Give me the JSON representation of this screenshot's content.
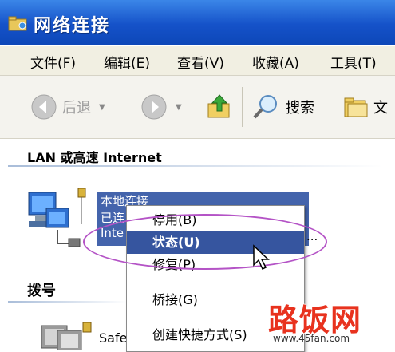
{
  "window": {
    "title": "网络连接",
    "icon": "network-folder-icon"
  },
  "menubar": {
    "items": [
      "文件(F)",
      "编辑(E)",
      "查看(V)",
      "收藏(A)",
      "工具(T)"
    ]
  },
  "toolbar": {
    "back_label": "后退",
    "search_label": "搜索",
    "folders_label": "文",
    "icons": [
      "back-arrow-icon",
      "forward-arrow-icon",
      "up-folder-icon",
      "search-icon",
      "folders-icon"
    ]
  },
  "content": {
    "section_lan": "LAN 或高速 Internet",
    "section_dialup": "拨号",
    "lan_connection_lines": [
      "本地连接",
      "已连",
      "Inte"
    ],
    "dialup_connection_label": "Safe"
  },
  "context_menu": {
    "items": [
      {
        "label": "停用(B)",
        "state": "normal"
      },
      {
        "label": "状态(U)",
        "state": "highlighted"
      },
      {
        "label": "修复(P)",
        "state": "normal"
      },
      {
        "label": "桥接(G)",
        "state": "normal"
      },
      {
        "label": "创建快捷方式(S)",
        "state": "normal"
      }
    ],
    "ellipsis": "..."
  },
  "watermark": {
    "main": "路饭网",
    "url": "www.45fan.com"
  },
  "colors": {
    "titlebar": "#1552c9",
    "selection": "#36559f",
    "ellipse": "#b453c6",
    "watermark": "#e8321e"
  }
}
